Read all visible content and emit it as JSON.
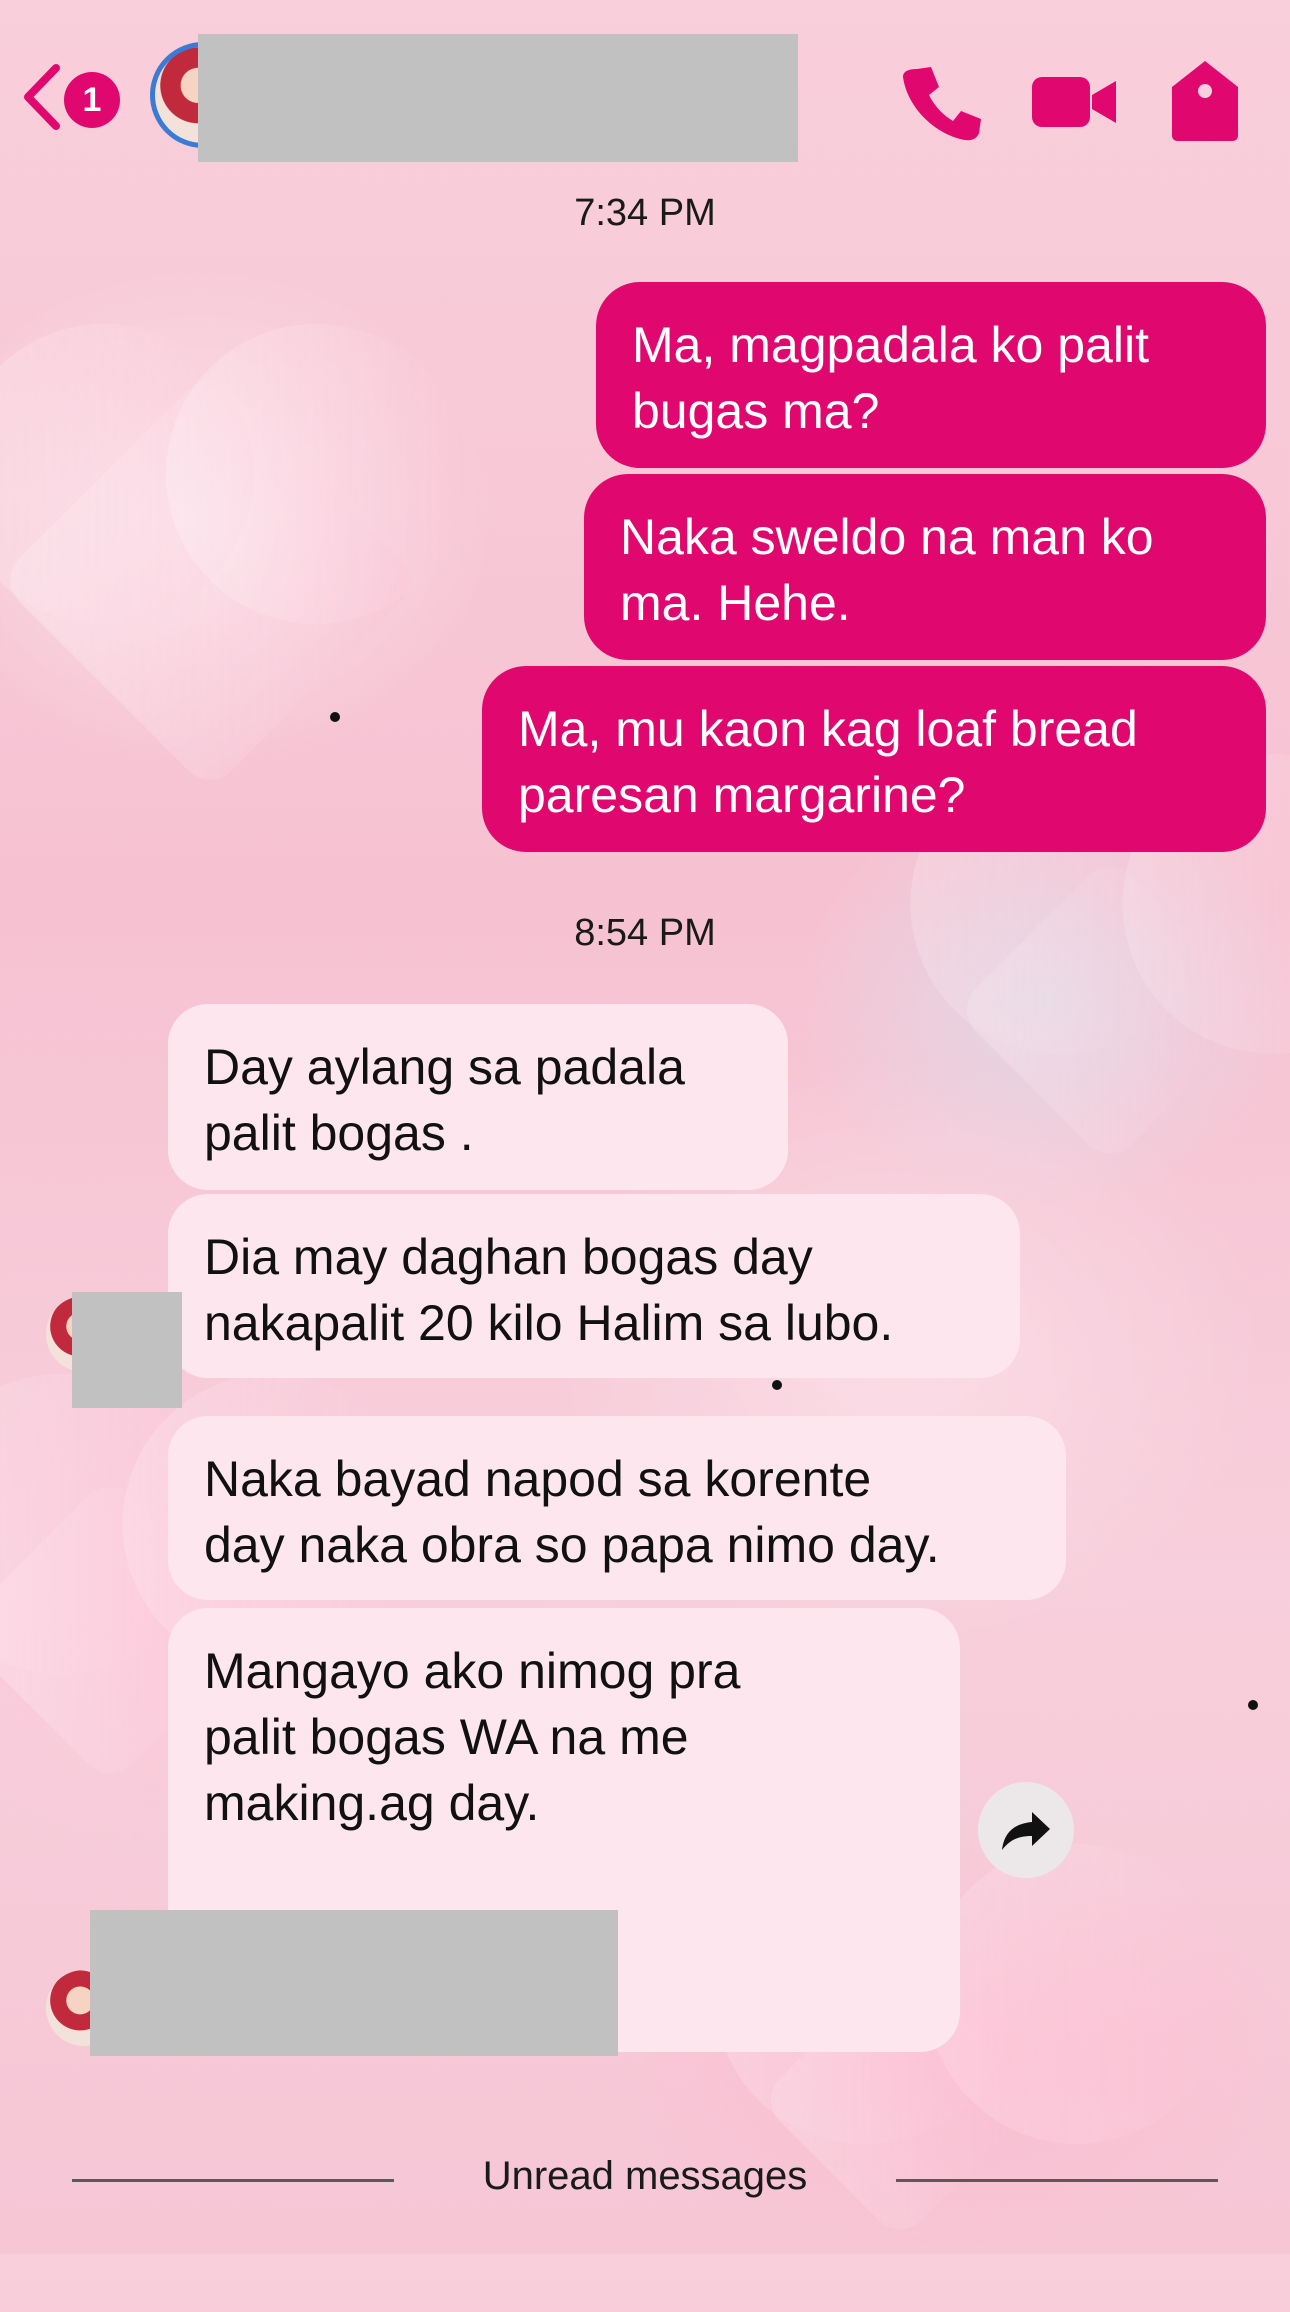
{
  "header": {
    "unread_count": "1",
    "icons": [
      "back-chevron-icon",
      "phone-icon",
      "video-icon",
      "tag-icon"
    ],
    "accent_color": "#e0076f"
  },
  "messages": {
    "time_1": "7:34 PM",
    "out_1": "Ma, magpadala ko palit\nbugas ma?",
    "out_2": "Naka sweldo na man ko\nma. Hehe.",
    "out_3": "Ma, mu kaon kag loaf bread\nparesan margarine?",
    "time_2": "8:54 PM",
    "in_1": "Day aylang sa padala\npalit bogas .",
    "in_2": "Dia may daghan bogas day\nnakapalit 20 kilo Halim sa lubo.",
    "in_3": "Naka bayad napod sa korente\nday naka obra so papa nimo day.",
    "in_4": "Mangayo ako nimog pra\npalit bogas WA na me\nmaking.ag day."
  },
  "footer": {
    "unread_label": "Unread messages"
  },
  "colors": {
    "outgoing_bubble": "#e0076f",
    "incoming_bubble": "#fde6ee"
  }
}
